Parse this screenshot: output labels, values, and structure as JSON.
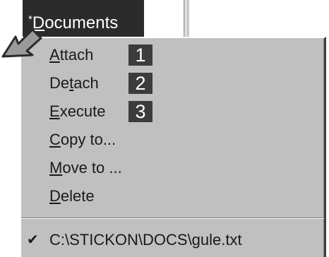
{
  "menu_header": {
    "prefix": "*",
    "accel": "D",
    "rest": "ocuments"
  },
  "menu": {
    "items": [
      {
        "accel": "A",
        "rest": "ttach",
        "badge": "1"
      },
      {
        "pre": "De",
        "accel": "t",
        "rest": "ach",
        "badge": "2"
      },
      {
        "accel": "E",
        "rest": "xecute",
        "badge": "3"
      },
      {
        "accel": "C",
        "rest": "opy to..."
      },
      {
        "accel": "M",
        "rest": "ove to ..."
      },
      {
        "accel": "D",
        "rest": "elete"
      }
    ],
    "recent_file": {
      "check": "✔",
      "path": "C:\\STICKON\\DOCS\\gule.txt"
    }
  },
  "icons": {
    "pointer": "arrow-pointer-icon",
    "checkmark": "check-icon"
  },
  "colors": {
    "menu_bg": "#c0c0c0",
    "header_bg": "#2b2b2b",
    "badge_bg": "#3c3c3c"
  }
}
